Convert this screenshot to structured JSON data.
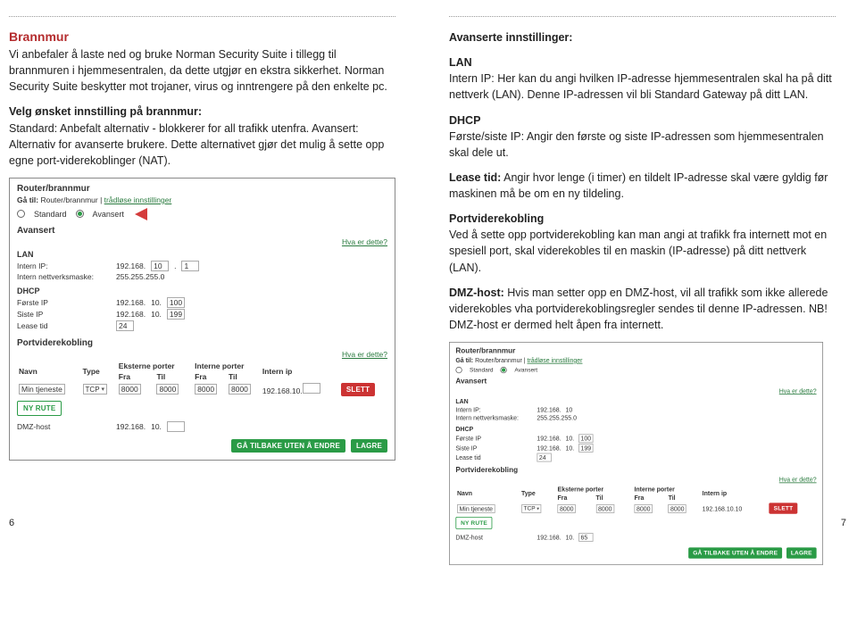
{
  "left": {
    "heading": "Brannmur",
    "para1": "Vi anbefaler å laste ned og bruke Norman Security Suite i tillegg til brannmuren i hjemmesentralen, da dette utgjør en ekstra sikkerhet. Norman Security Suite beskytter mot trojaner, virus og inntrengere på den enkelte pc.",
    "sub1_title": "Velg ønsket innstilling på brannmur:",
    "sub1_body": "Standard: Anbefalt alternativ - blokkerer for all trafikk utenfra. Avansert: Alternativ for avanserte brukere. Dette alternativet gjør det mulig å sette opp egne port-viderekoblinger (NAT).",
    "page_num": "6"
  },
  "right": {
    "heading": "Avanserte innstillinger:",
    "lan_title": "LAN",
    "lan_body": "Intern IP: Her kan du angi hvilken IP-adresse hjemmesentralen skal ha på ditt nettverk (LAN). Denne IP-adressen vil bli Standard Gateway på  ditt LAN.",
    "dhcp_title": "DHCP",
    "dhcp_body": "Første/siste IP: Angir den første og siste IP-adressen som hjemmesentralen skal dele ut.",
    "lease_label": "Lease tid:",
    "lease_body": " Angir hvor lenge (i timer) en tildelt IP-adresse skal være gyldig før maskinen må be om en ny tildeling.",
    "portfwd_title": "Portviderekobling",
    "portfwd_body": "Ved å sette opp portviderekobling kan man angi at trafikk fra internett mot en spesiell port, skal viderekobles til en maskin (IP-adresse) på ditt nettverk (LAN).",
    "dmz_label": "DMZ-host:",
    "dmz_body": " Hvis man setter opp en DMZ-host, vil all trafikk som ikke allerede viderekobles vha portviderekoblingsregler sendes til denne IP-adressen. NB! DMZ-host er dermed helt åpen fra internett.",
    "page_num": "7"
  },
  "panel": {
    "title": "Router/brannmur",
    "goto_label": "Gå til:",
    "goto_text": "Router/brannmur |",
    "goto_link": "trådløse innstillinger",
    "radio_standard": "Standard",
    "radio_avansert": "Avansert",
    "section_avansert": "Avansert",
    "help": "Hva er dette?",
    "lan_h": "LAN",
    "lan_ip_label": "Intern IP:",
    "lan_ip_a": "192.168.",
    "lan_ip_b": "10",
    "lan_ip_c": "1",
    "mask_label": "Intern nettverksmaske:",
    "mask_val": "255.255.255.0",
    "dhcp_h": "DHCP",
    "first_label": "Første IP",
    "first_a": "192.168.",
    "first_b": "10.",
    "first_c": "100",
    "last_label": "Siste IP",
    "last_a": "192.168.",
    "last_b": "10.",
    "last_c": "199",
    "lease_label": "Lease tid",
    "lease_val": "24",
    "pvk_h": "Portviderekobling",
    "tbl_navn": "Navn",
    "tbl_type": "Type",
    "tbl_eks": "Eksterne porter",
    "tbl_int": "Interne porter",
    "tbl_fra": "Fra",
    "tbl_til": "Til",
    "tbl_internip": "Intern ip",
    "row_name": "Min tjeneste",
    "row_type": "TCP",
    "row_ef": "8000",
    "row_et": "8000",
    "row_if": "8000",
    "row_it": "8000",
    "row_ip_prefix": "192.168.10.",
    "btn_slett": "SLETT",
    "btn_nyrute": "NY RUTE",
    "dmz_label": "DMZ-host",
    "dmz_prefix": "192.168.",
    "dmz_b": "10.",
    "btn_back": "GÅ TILBAKE UTEN Å ENDRE",
    "btn_save": "LAGRE"
  },
  "panel2": {
    "lan_ip_b": "10",
    "row_ip_suffix": "10",
    "dmz_suffix": "65"
  }
}
